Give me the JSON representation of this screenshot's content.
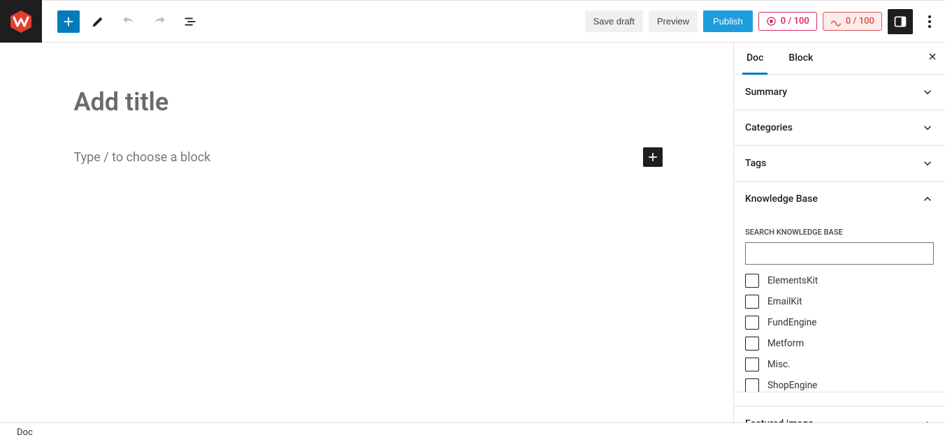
{
  "toolbar": {
    "save_draft_label": "Save draft",
    "preview_label": "Preview",
    "publish_label": "Publish",
    "score1": "0 / 100",
    "score2": "0 / 100"
  },
  "editor": {
    "title_placeholder": "Add title",
    "block_placeholder": "Type / to choose a block"
  },
  "sidebar": {
    "tabs": {
      "doc": "Doc",
      "block": "Block"
    },
    "panels": {
      "summary": "Summary",
      "categories": "Categories",
      "tags": "Tags",
      "knowledge_base": "Knowledge Base",
      "featured_image": "Featured image"
    },
    "kb": {
      "search_label": "SEARCH KNOWLEDGE BASE",
      "items": [
        "ElementsKit",
        "EmailKit",
        "FundEngine",
        "Metform",
        "Misc.",
        "ShopEngine"
      ]
    }
  },
  "statusbar": {
    "breadcrumb": "Doc"
  }
}
